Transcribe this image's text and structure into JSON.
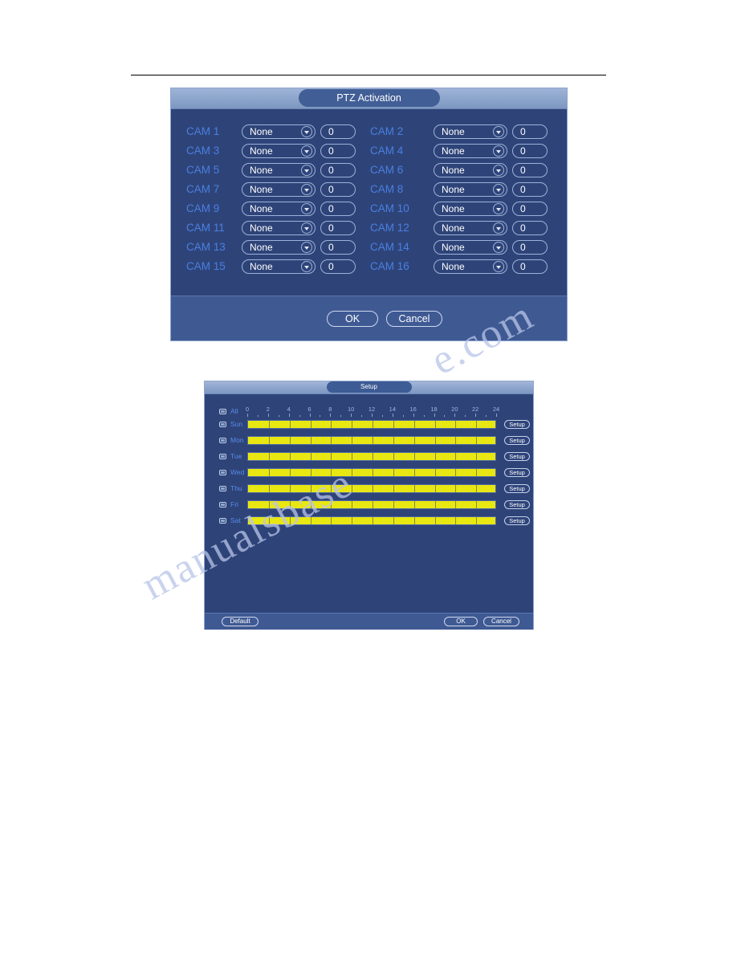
{
  "watermark": {
    "line1": "e.com",
    "line2": "manualsbase"
  },
  "ptz_dialog": {
    "title": "PTZ Activation",
    "rows": [
      {
        "left_label": "CAM 1",
        "left_select": "None",
        "left_value": "0",
        "right_label": "CAM 2",
        "right_select": "None",
        "right_value": "0"
      },
      {
        "left_label": "CAM 3",
        "left_select": "None",
        "left_value": "0",
        "right_label": "CAM 4",
        "right_select": "None",
        "right_value": "0"
      },
      {
        "left_label": "CAM 5",
        "left_select": "None",
        "left_value": "0",
        "right_label": "CAM 6",
        "right_select": "None",
        "right_value": "0"
      },
      {
        "left_label": "CAM 7",
        "left_select": "None",
        "left_value": "0",
        "right_label": "CAM 8",
        "right_select": "None",
        "right_value": "0"
      },
      {
        "left_label": "CAM 9",
        "left_select": "None",
        "left_value": "0",
        "right_label": "CAM 10",
        "right_select": "None",
        "right_value": "0"
      },
      {
        "left_label": "CAM 11",
        "left_select": "None",
        "left_value": "0",
        "right_label": "CAM 12",
        "right_select": "None",
        "right_value": "0"
      },
      {
        "left_label": "CAM 13",
        "left_select": "None",
        "left_value": "0",
        "right_label": "CAM 14",
        "right_select": "None",
        "right_value": "0"
      },
      {
        "left_label": "CAM 15",
        "left_select": "None",
        "left_value": "0",
        "right_label": "CAM 16",
        "right_select": "None",
        "right_value": "0"
      }
    ],
    "ok_label": "OK",
    "cancel_label": "Cancel",
    "select_options": [
      "None"
    ]
  },
  "setup_dialog": {
    "title": "Setup",
    "all_label": "All",
    "ruler_labels": [
      "0",
      "2",
      "4",
      "6",
      "8",
      "10",
      "12",
      "14",
      "16",
      "18",
      "20",
      "22",
      "24"
    ],
    "days": [
      {
        "label": "Sun",
        "setup_label": "Setup",
        "fill_percent": 100
      },
      {
        "label": "Mon",
        "setup_label": "Setup",
        "fill_percent": 100
      },
      {
        "label": "Tue",
        "setup_label": "Setup",
        "fill_percent": 100
      },
      {
        "label": "Wed",
        "setup_label": "Setup",
        "fill_percent": 100
      },
      {
        "label": "Thu",
        "setup_label": "Setup",
        "fill_percent": 100
      },
      {
        "label": "Fri",
        "setup_label": "Setup",
        "fill_percent": 100
      },
      {
        "label": "Sat",
        "setup_label": "Setup",
        "fill_percent": 100
      }
    ],
    "default_label": "Default",
    "ok_label": "OK",
    "cancel_label": "Cancel"
  },
  "colors": {
    "dialog_bg": "#2e4479",
    "accent_label": "#4a7fe0",
    "schedule_fill": "#e9e712",
    "titlebar": "#8fa7cd"
  }
}
